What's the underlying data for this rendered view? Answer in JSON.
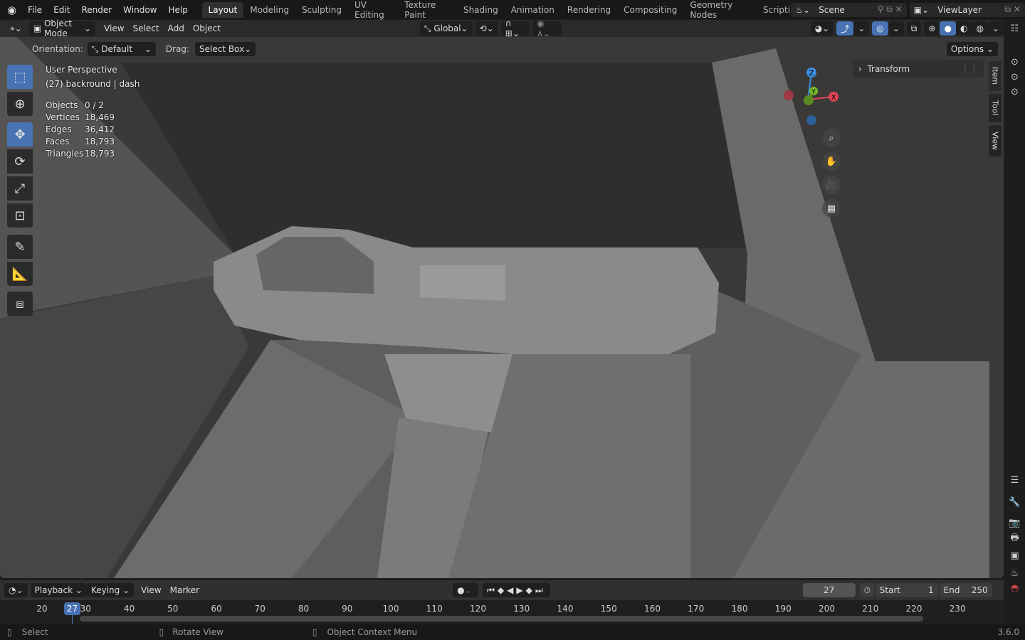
{
  "topbar": {
    "menus": [
      "File",
      "Edit",
      "Render",
      "Window",
      "Help"
    ],
    "workspaces": [
      "Layout",
      "Modeling",
      "Sculpting",
      "UV Editing",
      "Texture Paint",
      "Shading",
      "Animation",
      "Rendering",
      "Compositing",
      "Geometry Nodes",
      "Scripting"
    ],
    "active_workspace": "Layout",
    "scene": "Scene",
    "view_layer": "ViewLayer"
  },
  "header": {
    "mode": "Object Mode",
    "menus": [
      "View",
      "Select",
      "Add",
      "Object"
    ],
    "orientation": "Global"
  },
  "tool_settings": {
    "orientation_label": "Orientation:",
    "orientation": "Default",
    "drag_label": "Drag:",
    "drag": "Select Box",
    "options": "Options"
  },
  "overlay": {
    "view_name": "User Perspective",
    "collection": "(27) backround | dash",
    "stats": [
      {
        "label": "Objects",
        "value": "0 / 2"
      },
      {
        "label": "Vertices",
        "value": "18,469"
      },
      {
        "label": "Edges",
        "value": "36,412"
      },
      {
        "label": "Faces",
        "value": "18,793"
      },
      {
        "label": "Triangles",
        "value": "18,793"
      }
    ]
  },
  "sidebar": {
    "panel": "Transform",
    "tabs": [
      "Item",
      "Tool",
      "View"
    ]
  },
  "gizmo": {
    "x": "X",
    "y": "Y",
    "z": "Z",
    "colors": {
      "x": "#e04555",
      "y": "#76b82a",
      "z": "#3d8fe0"
    }
  },
  "timeline": {
    "menus": [
      "Playback",
      "Keying",
      "View",
      "Marker"
    ],
    "current_frame": "27",
    "start_label": "Start",
    "start": "1",
    "end_label": "End",
    "end": "250",
    "ticks": [
      "20",
      "30",
      "40",
      "50",
      "60",
      "70",
      "80",
      "90",
      "100",
      "110",
      "120",
      "130",
      "140",
      "150",
      "160",
      "170",
      "180",
      "190",
      "200",
      "210",
      "220",
      "230"
    ]
  },
  "status": {
    "select": "Select",
    "rotate": "Rotate View",
    "context": "Object Context Menu",
    "version": "3.6.0"
  },
  "colors": {
    "accent": "#4772b3"
  }
}
